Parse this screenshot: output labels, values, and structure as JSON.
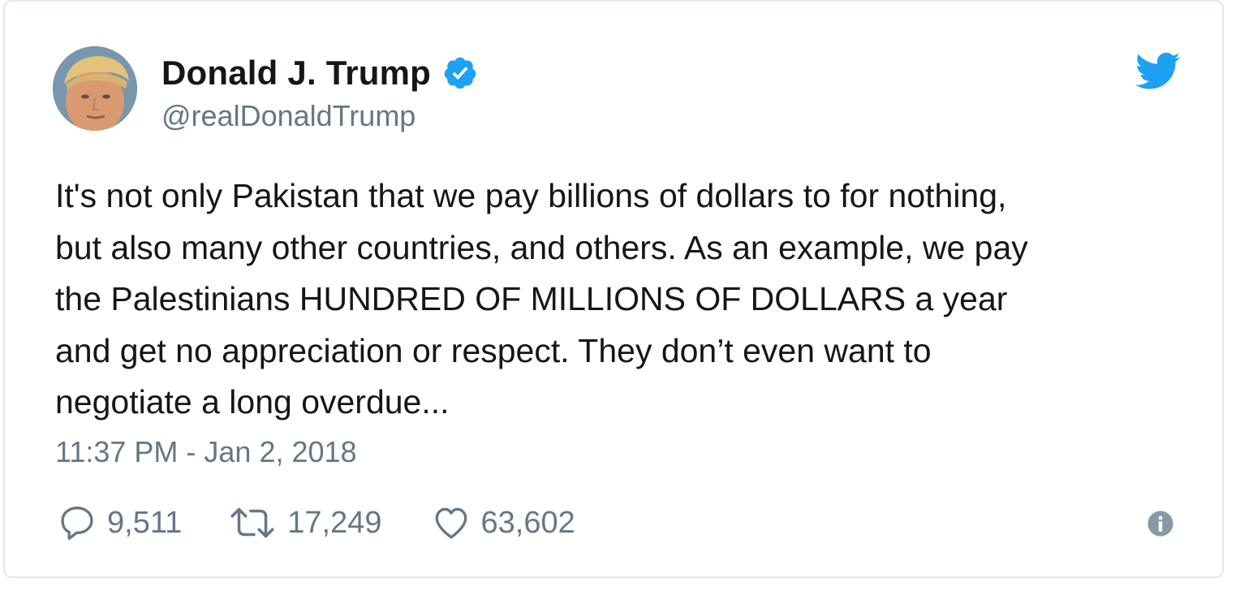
{
  "tweet": {
    "author": {
      "name": "Donald J. Trump",
      "handle": "@realDonaldTrump",
      "verified": true,
      "avatar_icon": "profile-photo"
    },
    "text_lines": [
      "It's not only Pakistan that we pay billions of dollars to for nothing,",
      "but also many other countries, and others. As an example, we pay",
      "the Palestinians HUNDRED OF MILLIONS OF DOLLARS a year",
      "and get no appreciation or respect. They don’t even want to",
      "negotiate a long overdue..."
    ],
    "timestamp": "11:37 PM - Jan 2, 2018",
    "stats": {
      "replies": "9,511",
      "retweets": "17,249",
      "likes": "63,602"
    },
    "icons": {
      "brand": "twitter-bird-icon",
      "verified": "verified-badge-icon",
      "reply": "reply-icon",
      "retweet": "retweet-icon",
      "like": "heart-icon",
      "info": "info-icon"
    }
  },
  "colors": {
    "twitter_blue": "#1da1f2",
    "text_primary": "#14171a",
    "text_secondary": "#657786",
    "border": "#e1e8ed"
  }
}
